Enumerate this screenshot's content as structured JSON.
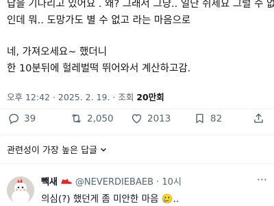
{
  "tweet": {
    "lines": [
      "답을 기다리고 있어요 . 왜? 그래서 그냥.. 일단 쉬세요 그럴 수 없",
      "인데 뭐.. 도망가도 별 수 없고 라는 마음으로",
      "네, 가져오세요~ 했더니",
      "한 10분뒤에 헐레벌떡 뛰어와서 계산하고감."
    ],
    "meta_prefix": "오후 12:42 · 2025. 2. 19. · 조회 ",
    "views": "20만회"
  },
  "actions": {
    "replies": "39",
    "retweets": "2,050",
    "likes": "2013",
    "bookmarks": "82"
  },
  "sort": {
    "label": "관련성이 가장 높은 답글"
  },
  "reply": {
    "name": "빽새",
    "handle": "@NEVERDIEBAEB · 10시",
    "text": "의심(?) 했던게 좀 미안한 마음",
    "emoji": "🥲",
    "suffix": ".."
  },
  "colors": {
    "text": "#0f1419",
    "secondary": "#536471",
    "divider": "#eff3f4",
    "accent": "#1d9bf0"
  }
}
